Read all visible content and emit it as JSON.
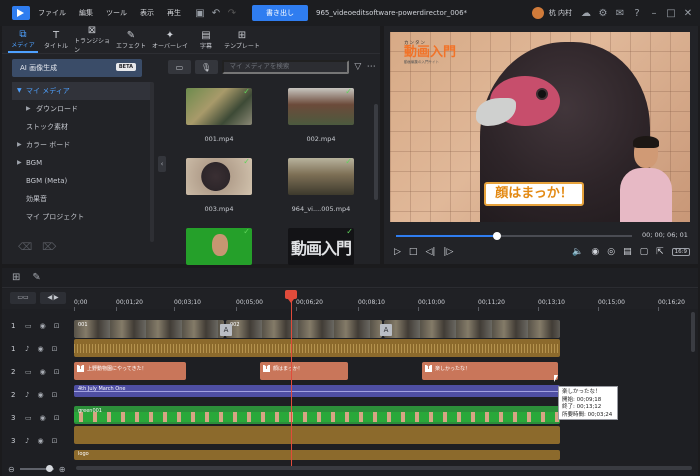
{
  "titlebar": {
    "menus": [
      "ファイル",
      "編集",
      "ツール",
      "表示",
      "再生"
    ],
    "export_label": "書き出し",
    "project_name": "965_videoeditsoftware-powerdirector_006*",
    "user_name": "杭 内村"
  },
  "tabs": [
    {
      "label": "メディア",
      "icon": "media-icon"
    },
    {
      "label": "タイトル",
      "icon": "title-icon"
    },
    {
      "label": "トランジション",
      "icon": "transition-icon"
    },
    {
      "label": "エフェクト",
      "icon": "effect-icon"
    },
    {
      "label": "オーバーレイ",
      "icon": "overlay-icon"
    },
    {
      "label": "字幕",
      "icon": "subtitle-icon"
    },
    {
      "label": "テンプレート",
      "icon": "template-icon"
    }
  ],
  "ai_button": {
    "label": "AI 画像生成",
    "badge": "BETA"
  },
  "tree": [
    "マイ メディア",
    "ダウンロード",
    "ストック素材",
    "カラー ボード",
    "BGM",
    "BGM (Meta)",
    "効果音",
    "マイ プロジェクト"
  ],
  "media_search": {
    "placeholder": "マイ メディアを検索"
  },
  "media_items": [
    {
      "label": "001.mp4"
    },
    {
      "label": "002.mp4"
    },
    {
      "label": "003.mp4"
    },
    {
      "label": "964_vi....005.mp4"
    },
    {
      "label": ""
    },
    {
      "label": ""
    }
  ],
  "media_logo_text": "動画入門",
  "preview": {
    "logo_sub": "カンタン",
    "logo_main": "動画入門",
    "logo_caption": "動画編集の入門サイト",
    "caption": "顔はまっか！",
    "timecode": "00; 00; 06; 01",
    "progress_fraction": 0.43,
    "ratio_label": "16:9"
  },
  "ruler": {
    "ticks": [
      "0;00",
      "00;01;20",
      "00;03;10",
      "00;05;00",
      "00;06;20",
      "00;08;10",
      "00;10;00",
      "00;11;20",
      "00;13;10",
      "00;15;00",
      "00;16;20"
    ]
  },
  "tracks": [
    {
      "num": "1",
      "type": "video"
    },
    {
      "num": "1",
      "type": "audio"
    },
    {
      "num": "2",
      "type": "video"
    },
    {
      "num": "2",
      "type": "audio"
    },
    {
      "num": "3",
      "type": "video"
    },
    {
      "num": "3",
      "type": "audio"
    }
  ],
  "clips": {
    "video1": [
      "001",
      "002",
      ""
    ],
    "transition": "A",
    "titles": [
      "上野動物園にやってきた！",
      "顔はまっか！",
      "楽しかったな！"
    ],
    "music": "4th July March One",
    "green": "green001",
    "logo": "logo"
  },
  "tooltip": {
    "title": "楽しかったな！",
    "start": "開始: 00;09;18",
    "end": "終了: 00;13;12",
    "duration": "所要時間: 00;03;24"
  }
}
